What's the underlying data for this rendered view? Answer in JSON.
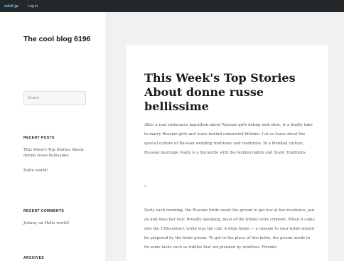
{
  "adminbar": {
    "brand": "adult.jp",
    "login": "Log in"
  },
  "site": {
    "title": "The cool blog 6196"
  },
  "search": {
    "placeholder": "Search…"
  },
  "widgets": {
    "recent_posts": {
      "title": "RECENT POSTS",
      "items": [
        "This Week's Top Stories About donne russe bellissime",
        "Hello world!"
      ]
    },
    "recent_comments": {
      "title": "RECENT COMMENTS",
      "items": [
        "Johnny on Hello world!"
      ]
    },
    "archives": {
      "title": "ARCHIVES"
    }
  },
  "post": {
    "title": "This Week's Top Stories About donne russe bellissime",
    "para1": "After a real endurance marathon about Russian girls dating web sites, it is finally time to marry Russian girls and leave behind unmarried lifetime. Let us learn about the special culture of Russian wedding traditions and traditions. In a blended culture, Russian marriage really is a big kettle with the fashion habits and Slavic traditions.",
    "more": "»",
    "para2": "Early each morning, the Russian bride await the groom to get her at her residence, put on and fixes her hair. Broadly speaking, most of the brides wore crimson. When it came into the 19thcentury, white was the cult. A little funds — a ransom to your bride should be prepared by the bride groom. To get to the place of this bride, the groom needs to fix some tasks such as riddles that are planned by relatives. Friends"
  }
}
